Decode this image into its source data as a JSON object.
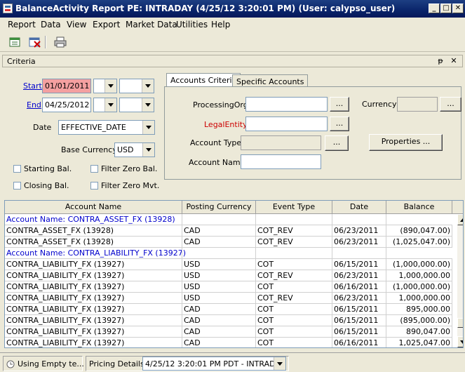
{
  "window": {
    "title": "BalanceActivity Report PE: INTRADAY (4/25/12 3:20:01 PM) (User: calypso_user)",
    "minimize_glyph": "_",
    "maximize_glyph": "□",
    "close_glyph": "✕"
  },
  "menu": [
    "Report",
    "Data",
    "View",
    "Export",
    "Market Data",
    "Utilities",
    "Help"
  ],
  "toolbar": {
    "icons": [
      "load-report-icon",
      "clear-report-icon",
      "print-icon"
    ]
  },
  "criteria": {
    "header": "Criteria",
    "pin_glyph": "ᵽ",
    "close_glyph": "✕",
    "start_label": "Start",
    "start_value": "01/01/2011",
    "end_label": "End",
    "end_value": "04/25/2012",
    "date_label": "Date",
    "date_value": "EFFECTIVE_DATE",
    "base_currency_label": "Base Currency",
    "base_currency_value": "USD",
    "starting_bal_label": "Starting Bal.",
    "filter_zero_bal_label": "Filter Zero Bal.",
    "closing_bal_label": "Closing Bal.",
    "filter_zero_mvt_label": "Filter Zero Mvt."
  },
  "accounts": {
    "tabs": [
      "Accounts Criteria",
      "Specific Accounts"
    ],
    "processing_org_label": "ProcessingOrg",
    "legal_entity_label": "LegalEntity",
    "account_type_label": "Account Type",
    "account_name_label": "Account Name",
    "currency_label": "Currency",
    "ellipsis": "...",
    "properties_button": "Properties ..."
  },
  "table": {
    "columns": [
      "Account Name",
      "Posting Currency",
      "Event Type",
      "Date",
      "Balance"
    ],
    "rows": [
      {
        "group": "Account Name: CONTRA_ASSET_FX (13928)"
      },
      {
        "cells": [
          "CONTRA_ASSET_FX (13928)",
          "CAD",
          "COT_REV",
          "06/23/2011",
          "(890,047.00)"
        ]
      },
      {
        "cells": [
          "CONTRA_ASSET_FX (13928)",
          "CAD",
          "COT_REV",
          "06/23/2011",
          "(1,025,047.00)"
        ]
      },
      {
        "group": "Account Name: CONTRA_LIABILITY_FX (13927)"
      },
      {
        "cells": [
          "CONTRA_LIABILITY_FX (13927)",
          "USD",
          "COT",
          "06/15/2011",
          "(1,000,000.00)"
        ]
      },
      {
        "cells": [
          "CONTRA_LIABILITY_FX (13927)",
          "USD",
          "COT_REV",
          "06/23/2011",
          "1,000,000.00"
        ]
      },
      {
        "cells": [
          "CONTRA_LIABILITY_FX (13927)",
          "USD",
          "COT",
          "06/16/2011",
          "(1,000,000.00)"
        ]
      },
      {
        "cells": [
          "CONTRA_LIABILITY_FX (13927)",
          "USD",
          "COT_REV",
          "06/23/2011",
          "1,000,000.00"
        ]
      },
      {
        "cells": [
          "CONTRA_LIABILITY_FX (13927)",
          "CAD",
          "COT",
          "06/15/2011",
          "895,000.00"
        ]
      },
      {
        "cells": [
          "CONTRA_LIABILITY_FX (13927)",
          "CAD",
          "COT",
          "06/15/2011",
          "(895,000.00)"
        ]
      },
      {
        "cells": [
          "CONTRA_LIABILITY_FX (13927)",
          "CAD",
          "COT",
          "06/15/2011",
          "890,047.00"
        ]
      },
      {
        "cells": [
          "CONTRA_LIABILITY_FX (13927)",
          "CAD",
          "COT",
          "06/16/2011",
          "1,025,047.00"
        ]
      }
    ]
  },
  "status": {
    "template_label": "Using Empty te...",
    "pricing_label": "Pricing Details:",
    "pricing_value": "4/25/12 3:20:01 PM PDT - INTRADAY"
  },
  "colors": {
    "title_bar": "#0a246a",
    "required_field": "#f4a0a0",
    "link_blue": "#0000cc",
    "mandatory_red": "#cc0000"
  }
}
